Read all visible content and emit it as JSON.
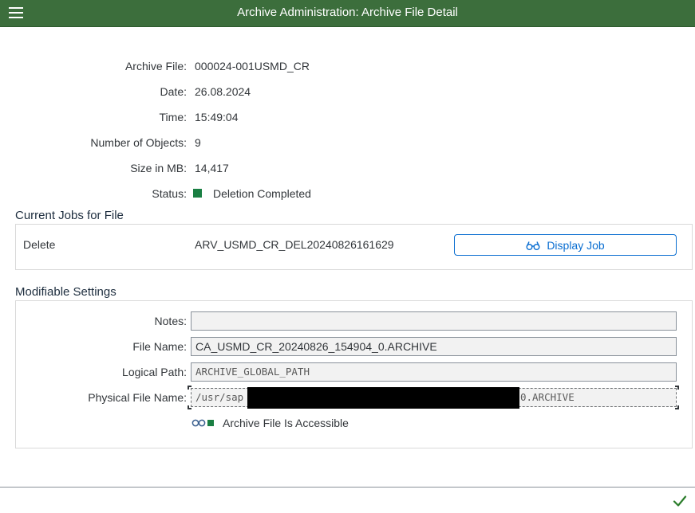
{
  "header": {
    "title": "Archive Administration: Archive File Detail",
    "menu_icon": "hamburger-menu-icon"
  },
  "details": {
    "archive_file_label": "Archive File:",
    "archive_file_value": "000024-001USMD_CR",
    "date_label": "Date:",
    "date_value": "26.08.2024",
    "time_label": "Time:",
    "time_value": "15:49:04",
    "objects_label": "Number of Objects:",
    "objects_value": "9",
    "size_label": "Size in MB:",
    "size_value": "14,417",
    "status_label": "Status:",
    "status_value": "Deletion Completed",
    "status_color": "#1a7f43"
  },
  "jobs": {
    "title": "Current Jobs for File",
    "job_type": "Delete",
    "job_name": "ARV_USMD_CR_DEL20240826161629",
    "display_button": "Display Job",
    "display_icon": "glasses-icon"
  },
  "settings": {
    "title": "Modifiable Settings",
    "notes_label": "Notes:",
    "notes_value": "",
    "file_name_label": "File Name:",
    "file_name_value": "CA_USMD_CR_20240826_154904_0.ARCHIVE",
    "logical_path_label": "Logical Path:",
    "logical_path_value": "ARCHIVE_GLOBAL_PATH",
    "physical_label": "Physical File Name:",
    "physical_prefix": "/usr/sap",
    "physical_suffix": "0.ARCHIVE",
    "accessible_text": "Archive File Is Accessible",
    "accessible_icon": "traffic-light-status-icon",
    "accent_color": "#0a6ed1"
  },
  "footer": {
    "confirm_icon": "checkmark-icon"
  }
}
